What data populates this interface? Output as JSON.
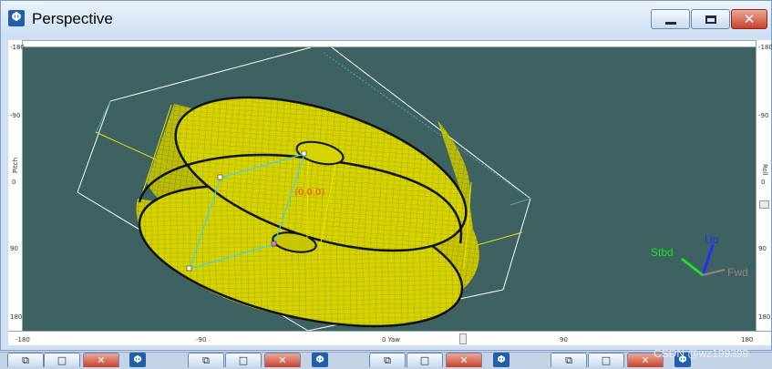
{
  "window": {
    "title": "Perspective",
    "app_icon_glyph": "Φ",
    "controls": {
      "minimize": "minimize-icon",
      "maximize": "maximize-icon",
      "close": "close-icon"
    }
  },
  "rulers": {
    "top_left_tick": "-180",
    "left_ticks": [
      "-180",
      "-90",
      "0",
      "90",
      "180"
    ],
    "left_label": "Pitch",
    "right_ticks": [
      "-180",
      "-90",
      "0",
      "90",
      "180"
    ],
    "right_label": "Roll",
    "bottom_ticks": [
      "-180",
      "-90",
      "0 Yaw",
      "90",
      "180"
    ]
  },
  "viewport": {
    "background": "#3e6262",
    "model_color": "#e6e600",
    "axes": {
      "up": "Up",
      "stbd": "Stbd",
      "fwd": "Fwd"
    },
    "axis_colors": {
      "up": "#2030ff",
      "stbd": "#20e020",
      "fwd": "#a08080"
    },
    "annotation": "(0,0,0)",
    "annotation_color": "#ff4020"
  },
  "taskbar": {
    "groups": [
      {
        "icon": "Φ"
      },
      {
        "icon": "Φ"
      },
      {
        "icon": "Φ"
      },
      {
        "icon": "Φ"
      }
    ],
    "watermark": "CSDN @wz199399"
  }
}
